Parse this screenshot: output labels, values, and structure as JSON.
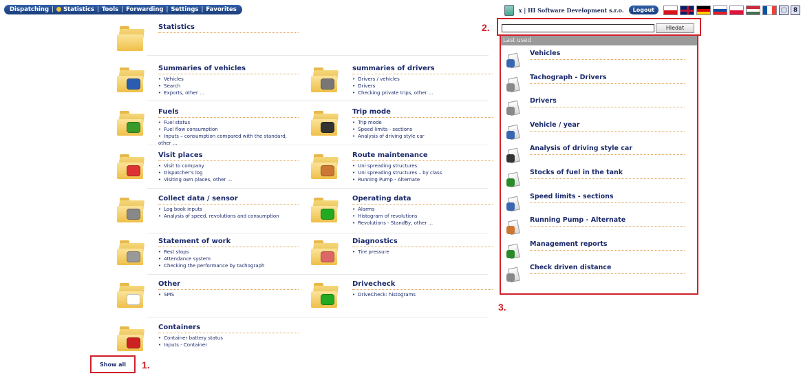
{
  "nav": {
    "items": [
      "Dispatching",
      "Statistics",
      "Tools",
      "Forwarding",
      "Settings",
      "Favorites"
    ]
  },
  "header": {
    "user_text": "x  |  HI Software Development s.r.o.",
    "logout_label": "Logout",
    "flags": [
      "cz",
      "uk",
      "de",
      "sk",
      "pl",
      "hu",
      "fr"
    ],
    "icons": [
      "document-icon",
      "address-book-icon"
    ]
  },
  "statistics": {
    "title": "Statistics"
  },
  "sections": [
    {
      "title": "Summaries of vehicles",
      "items": [
        "Vehicles",
        "Search",
        "Exports, other ..."
      ]
    },
    {
      "title": "summaries of drivers",
      "items": [
        "Drivers / vehicles",
        "Drivers",
        "Checking private trips, other ..."
      ]
    },
    {
      "title": "Fuels",
      "items": [
        "Fuel status",
        "Fuel flow consumption",
        "Inputs – consumption compared with the standard, other ..."
      ]
    },
    {
      "title": "Trip mode",
      "items": [
        "Trip mode",
        "Speed limits - sections",
        "Analysis of driving style car"
      ]
    },
    {
      "title": "Visit places",
      "items": [
        "Visit to company",
        "Dispatcher's log",
        "Visiting own places, other ..."
      ]
    },
    {
      "title": "Route maintenance",
      "items": [
        "Uni spreading structures",
        "Uni spreading structures – by class",
        "Running Pump - Alternate"
      ]
    },
    {
      "title": "Collect data / sensor",
      "items": [
        "Log book inputs",
        "Analysis of speed, revolutions and consumption"
      ]
    },
    {
      "title": "Operating data",
      "items": [
        "Alarms",
        "Histogram of revolutions",
        "Revolutions - StandBy, other ..."
      ]
    },
    {
      "title": "Statement of work",
      "items": [
        "Rest stops",
        "Attendance system",
        "Checking the performance by tachograph"
      ]
    },
    {
      "title": "Diagnostics",
      "items": [
        "Tire pressure"
      ]
    },
    {
      "title": "Other",
      "items": [
        "SMS"
      ]
    },
    {
      "title": "Drivecheck",
      "items": [
        "DriveCheck: histograms"
      ]
    },
    {
      "title": "Containers",
      "items": [
        "Container battery status",
        "Inputs - Container"
      ]
    }
  ],
  "show_all_label": "Show all",
  "search": {
    "button_label": "Hledat",
    "value": ""
  },
  "last_used": {
    "title": "Last used",
    "items": [
      "Vehicles",
      "Tachograph - Drivers",
      "Drivers",
      "Vehicle / year",
      "Analysis of driving style car",
      "Stocks of fuel in the tank",
      "Speed limits - sections",
      "Running Pump - Alternate",
      "Management reports",
      "Check driven distance"
    ]
  },
  "callouts": [
    "1.",
    "2.",
    "3."
  ]
}
